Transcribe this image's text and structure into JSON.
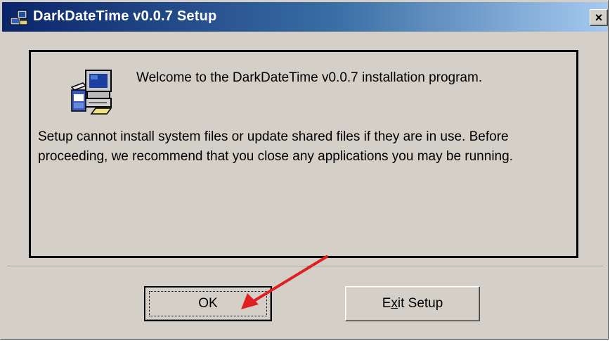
{
  "window": {
    "title": "DarkDateTime v0.0.7 Setup",
    "close_glyph": "×"
  },
  "panel": {
    "welcome": "Welcome to the DarkDateTime v0.0.7 installation program.",
    "message": "Setup cannot install system files or update shared files if they are in use. Before proceeding, we recommend that you close any applications you may be running."
  },
  "buttons": {
    "ok_label": "OK",
    "exit_label": "Exit Setup"
  },
  "icons": {
    "title": "setup-app-icon",
    "panel": "computer-setup-icon",
    "annotation": "red-arrow-icon"
  },
  "colors": {
    "titlebar_start": "#0a246a",
    "titlebar_end": "#a6caf0",
    "window_bg": "#d4d0c8",
    "annotation": "#e02020"
  }
}
